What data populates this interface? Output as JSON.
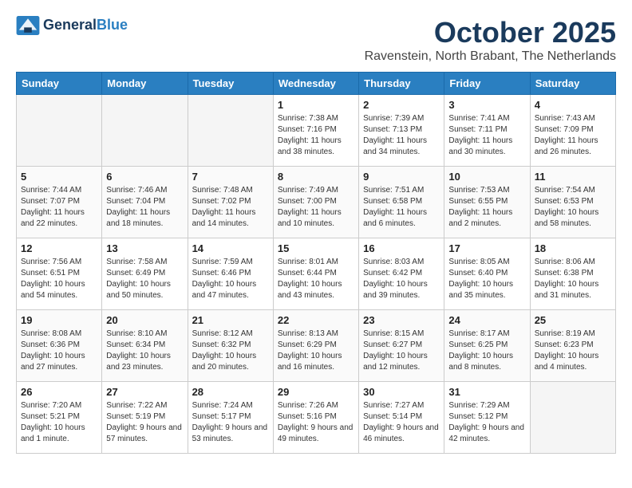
{
  "header": {
    "logo_line1": "General",
    "logo_line2": "Blue",
    "month": "October 2025",
    "location": "Ravenstein, North Brabant, The Netherlands"
  },
  "days_of_week": [
    "Sunday",
    "Monday",
    "Tuesday",
    "Wednesday",
    "Thursday",
    "Friday",
    "Saturday"
  ],
  "weeks": [
    [
      {
        "day": "",
        "empty": true
      },
      {
        "day": "",
        "empty": true
      },
      {
        "day": "",
        "empty": true
      },
      {
        "day": "1",
        "sunrise": "7:38 AM",
        "sunset": "7:16 PM",
        "daylight": "11 hours and 38 minutes."
      },
      {
        "day": "2",
        "sunrise": "7:39 AM",
        "sunset": "7:13 PM",
        "daylight": "11 hours and 34 minutes."
      },
      {
        "day": "3",
        "sunrise": "7:41 AM",
        "sunset": "7:11 PM",
        "daylight": "11 hours and 30 minutes."
      },
      {
        "day": "4",
        "sunrise": "7:43 AM",
        "sunset": "7:09 PM",
        "daylight": "11 hours and 26 minutes."
      }
    ],
    [
      {
        "day": "5",
        "sunrise": "7:44 AM",
        "sunset": "7:07 PM",
        "daylight": "11 hours and 22 minutes."
      },
      {
        "day": "6",
        "sunrise": "7:46 AM",
        "sunset": "7:04 PM",
        "daylight": "11 hours and 18 minutes."
      },
      {
        "day": "7",
        "sunrise": "7:48 AM",
        "sunset": "7:02 PM",
        "daylight": "11 hours and 14 minutes."
      },
      {
        "day": "8",
        "sunrise": "7:49 AM",
        "sunset": "7:00 PM",
        "daylight": "11 hours and 10 minutes."
      },
      {
        "day": "9",
        "sunrise": "7:51 AM",
        "sunset": "6:58 PM",
        "daylight": "11 hours and 6 minutes."
      },
      {
        "day": "10",
        "sunrise": "7:53 AM",
        "sunset": "6:55 PM",
        "daylight": "11 hours and 2 minutes."
      },
      {
        "day": "11",
        "sunrise": "7:54 AM",
        "sunset": "6:53 PM",
        "daylight": "10 hours and 58 minutes."
      }
    ],
    [
      {
        "day": "12",
        "sunrise": "7:56 AM",
        "sunset": "6:51 PM",
        "daylight": "10 hours and 54 minutes."
      },
      {
        "day": "13",
        "sunrise": "7:58 AM",
        "sunset": "6:49 PM",
        "daylight": "10 hours and 50 minutes."
      },
      {
        "day": "14",
        "sunrise": "7:59 AM",
        "sunset": "6:46 PM",
        "daylight": "10 hours and 47 minutes."
      },
      {
        "day": "15",
        "sunrise": "8:01 AM",
        "sunset": "6:44 PM",
        "daylight": "10 hours and 43 minutes."
      },
      {
        "day": "16",
        "sunrise": "8:03 AM",
        "sunset": "6:42 PM",
        "daylight": "10 hours and 39 minutes."
      },
      {
        "day": "17",
        "sunrise": "8:05 AM",
        "sunset": "6:40 PM",
        "daylight": "10 hours and 35 minutes."
      },
      {
        "day": "18",
        "sunrise": "8:06 AM",
        "sunset": "6:38 PM",
        "daylight": "10 hours and 31 minutes."
      }
    ],
    [
      {
        "day": "19",
        "sunrise": "8:08 AM",
        "sunset": "6:36 PM",
        "daylight": "10 hours and 27 minutes."
      },
      {
        "day": "20",
        "sunrise": "8:10 AM",
        "sunset": "6:34 PM",
        "daylight": "10 hours and 23 minutes."
      },
      {
        "day": "21",
        "sunrise": "8:12 AM",
        "sunset": "6:32 PM",
        "daylight": "10 hours and 20 minutes."
      },
      {
        "day": "22",
        "sunrise": "8:13 AM",
        "sunset": "6:29 PM",
        "daylight": "10 hours and 16 minutes."
      },
      {
        "day": "23",
        "sunrise": "8:15 AM",
        "sunset": "6:27 PM",
        "daylight": "10 hours and 12 minutes."
      },
      {
        "day": "24",
        "sunrise": "8:17 AM",
        "sunset": "6:25 PM",
        "daylight": "10 hours and 8 minutes."
      },
      {
        "day": "25",
        "sunrise": "8:19 AM",
        "sunset": "6:23 PM",
        "daylight": "10 hours and 4 minutes."
      }
    ],
    [
      {
        "day": "26",
        "sunrise": "7:20 AM",
        "sunset": "5:21 PM",
        "daylight": "10 hours and 1 minute."
      },
      {
        "day": "27",
        "sunrise": "7:22 AM",
        "sunset": "5:19 PM",
        "daylight": "9 hours and 57 minutes."
      },
      {
        "day": "28",
        "sunrise": "7:24 AM",
        "sunset": "5:17 PM",
        "daylight": "9 hours and 53 minutes."
      },
      {
        "day": "29",
        "sunrise": "7:26 AM",
        "sunset": "5:16 PM",
        "daylight": "9 hours and 49 minutes."
      },
      {
        "day": "30",
        "sunrise": "7:27 AM",
        "sunset": "5:14 PM",
        "daylight": "9 hours and 46 minutes."
      },
      {
        "day": "31",
        "sunrise": "7:29 AM",
        "sunset": "5:12 PM",
        "daylight": "9 hours and 42 minutes."
      },
      {
        "day": "",
        "empty": true
      }
    ]
  ]
}
